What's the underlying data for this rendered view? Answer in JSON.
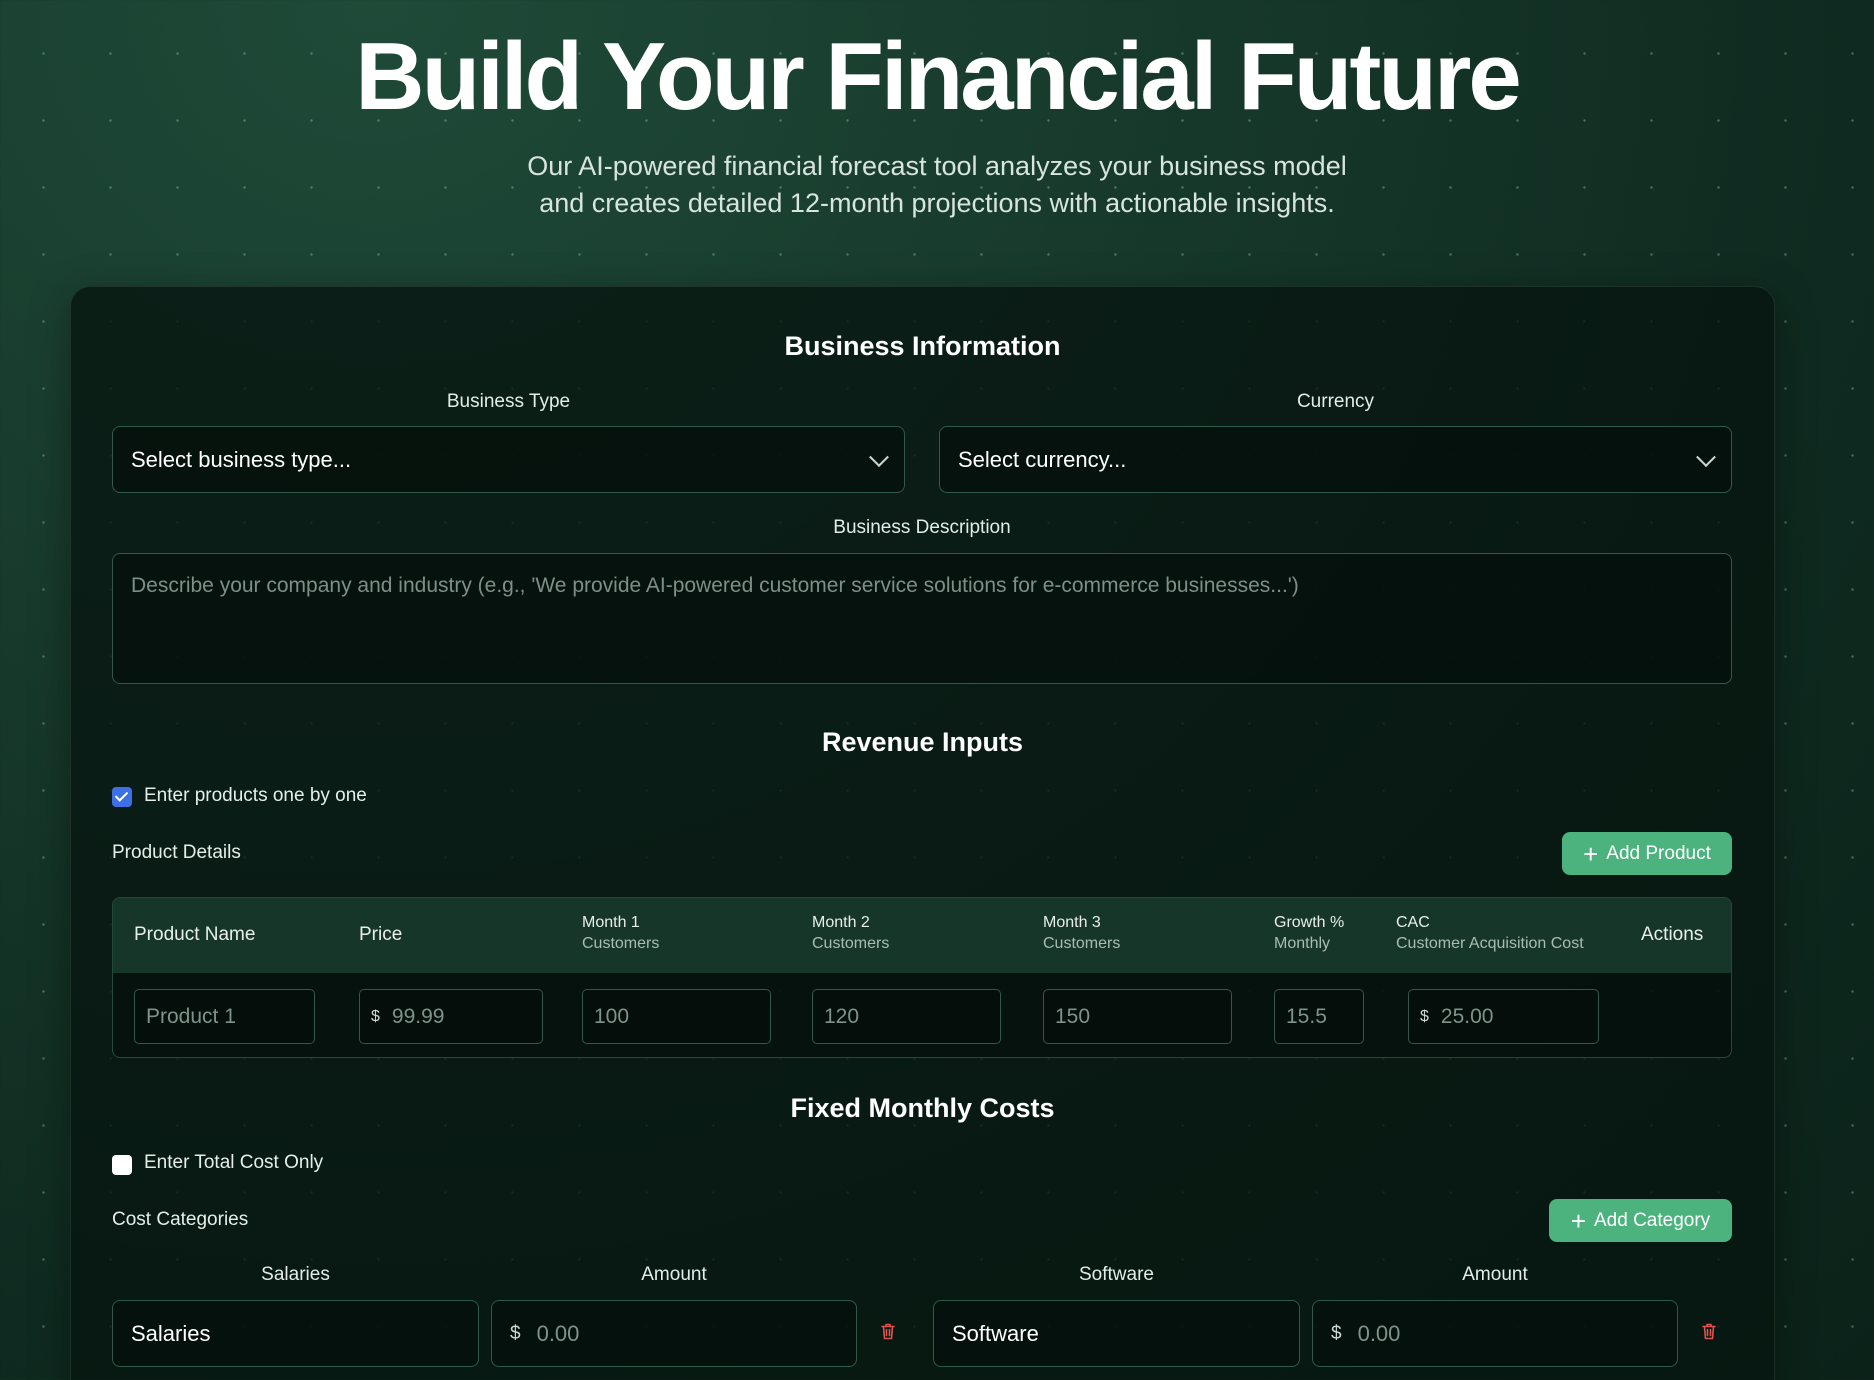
{
  "hero": {
    "title": "Build Your Financial Future",
    "subtitle_line1": "Our AI-powered financial forecast tool analyzes your business model",
    "subtitle_line2": "and creates detailed 12-month projections with actionable insights."
  },
  "business_info": {
    "title": "Business Information",
    "business_type_label": "Business Type",
    "business_type_value": "Select business type...",
    "currency_label": "Currency",
    "currency_value": "Select currency...",
    "description_label": "Business Description",
    "description_placeholder": "Describe your company and industry (e.g., 'We provide AI-powered customer service solutions for e-commerce businesses...')"
  },
  "revenue": {
    "title": "Revenue Inputs",
    "checkbox_label": "Enter products one by one",
    "checkbox_checked": true,
    "product_details_label": "Product Details",
    "add_product_label": "Add Product",
    "columns": {
      "name": "Product Name",
      "price": "Price",
      "month1": "Month 1",
      "month1_sub": "Customers",
      "month2": "Month 2",
      "month2_sub": "Customers",
      "month3": "Month 3",
      "month3_sub": "Customers",
      "growth": "Growth %",
      "growth_sub": "Monthly",
      "cac": "CAC",
      "cac_sub": "Customer Acquisition Cost",
      "actions": "Actions"
    },
    "row": {
      "name_placeholder": "Product 1",
      "price_currency": "$",
      "price_placeholder": "99.99",
      "month1_placeholder": "100",
      "month2_placeholder": "120",
      "month3_placeholder": "150",
      "growth_placeholder": "15.5",
      "cac_currency": "$",
      "cac_placeholder": "25.00"
    }
  },
  "fixed_costs": {
    "title": "Fixed Monthly Costs",
    "checkbox_label": "Enter Total Cost Only",
    "checkbox_checked": false,
    "categories_label": "Cost Categories",
    "add_category_label": "Add Category",
    "categories": [
      {
        "label": "Salaries",
        "amount_label": "Amount",
        "name_value": "Salaries",
        "currency": "$",
        "amount_placeholder": "0.00"
      },
      {
        "label": "Software",
        "amount_label": "Amount",
        "name_value": "Software",
        "currency": "$",
        "amount_placeholder": "0.00"
      }
    ]
  },
  "colors": {
    "accent_green": "#4cb37f",
    "checkbox_blue": "#3d6fe6",
    "delete_red": "#e0524f"
  },
  "icons": [
    "chevron-down-icon",
    "check-icon",
    "plus-icon",
    "trash-icon"
  ]
}
